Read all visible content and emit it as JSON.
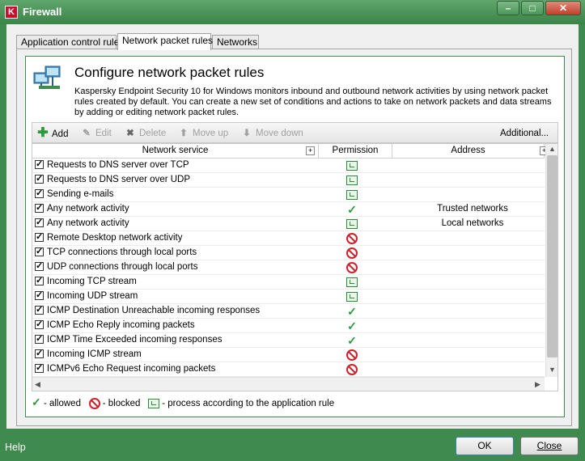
{
  "window": {
    "title": "Firewall",
    "min_icon": "minimize-icon",
    "max_icon": "maximize-icon",
    "close_icon": "close-icon"
  },
  "tabs": [
    {
      "label": "Application control rules"
    },
    {
      "label": "Network packet rules"
    },
    {
      "label": "Networks"
    }
  ],
  "header": {
    "title": "Configure network packet rules",
    "description": "Kaspersky Endpoint Security 10 for Windows monitors inbound and outbound network activities by using network packet rules created by default. You can create a new set of conditions and actions to take on network packets and data streams by adding or editing network packet rules."
  },
  "toolbar": {
    "add": "Add",
    "edit": "Edit",
    "delete": "Delete",
    "move_up": "Move up",
    "move_down": "Move down",
    "additional": "Additional..."
  },
  "table": {
    "columns": {
      "service": "Network service",
      "permission": "Permission",
      "address": "Address"
    },
    "rows": [
      {
        "service": "Requests to DNS server over TCP",
        "permission": "app",
        "address": ""
      },
      {
        "service": "Requests to DNS server over UDP",
        "permission": "app",
        "address": ""
      },
      {
        "service": "Sending e-mails",
        "permission": "app",
        "address": ""
      },
      {
        "service": "Any network activity",
        "permission": "allowed",
        "address": "Trusted networks"
      },
      {
        "service": "Any network activity",
        "permission": "app",
        "address": "Local networks"
      },
      {
        "service": "Remote Desktop network activity",
        "permission": "blocked",
        "address": ""
      },
      {
        "service": "TCP connections through local ports",
        "permission": "blocked",
        "address": ""
      },
      {
        "service": "UDP connections through local ports",
        "permission": "blocked",
        "address": ""
      },
      {
        "service": "Incoming TCP stream",
        "permission": "app",
        "address": ""
      },
      {
        "service": "Incoming UDP stream",
        "permission": "app",
        "address": ""
      },
      {
        "service": "ICMP Destination Unreachable incoming responses",
        "permission": "allowed",
        "address": ""
      },
      {
        "service": "ICMP Echo Reply incoming packets",
        "permission": "allowed",
        "address": ""
      },
      {
        "service": "ICMP Time Exceeded incoming responses",
        "permission": "allowed",
        "address": ""
      },
      {
        "service": "Incoming ICMP stream",
        "permission": "blocked",
        "address": ""
      },
      {
        "service": "ICMPv6 Echo Request incoming packets",
        "permission": "blocked",
        "address": ""
      }
    ]
  },
  "legend": {
    "allowed": "- allowed",
    "blocked": "- blocked",
    "app": "- process according to the application rule"
  },
  "footer": {
    "help": "Help",
    "ok": "OK",
    "close": "Close"
  },
  "colors": {
    "accent": "#3f8a4e",
    "allowed": "#2a9a3a",
    "blocked": "#d0202a"
  }
}
